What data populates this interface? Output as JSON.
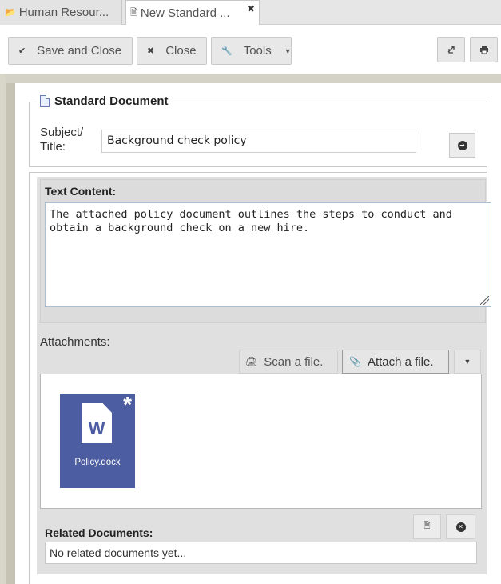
{
  "tabs": [
    {
      "label": "Human Resour...",
      "icon": "folder-open-icon"
    },
    {
      "label": "New Standard ...",
      "icon": "document-icon",
      "close": "✖"
    }
  ],
  "toolbar": {
    "save_label": "Save and Close",
    "close_label": "Close",
    "tools_label": "Tools"
  },
  "form": {
    "legend": "Standard Document",
    "subject_label": "Subject/ Title:",
    "subject_value": "Background check policy",
    "text_content_label": "Text Content:",
    "text_content": "The attached policy document outlines the steps to conduct and obtain a background check on a new hire.",
    "attachments_label": "Attachments:",
    "scan_label": "Scan a file.",
    "attach_label": "Attach a file.",
    "attachment": {
      "name": "Policy.docx",
      "letter": "W",
      "badge": "*",
      "tile_color": "#4c5da2"
    },
    "related_label": "Related Documents:",
    "related_empty": "No related documents yet..."
  }
}
